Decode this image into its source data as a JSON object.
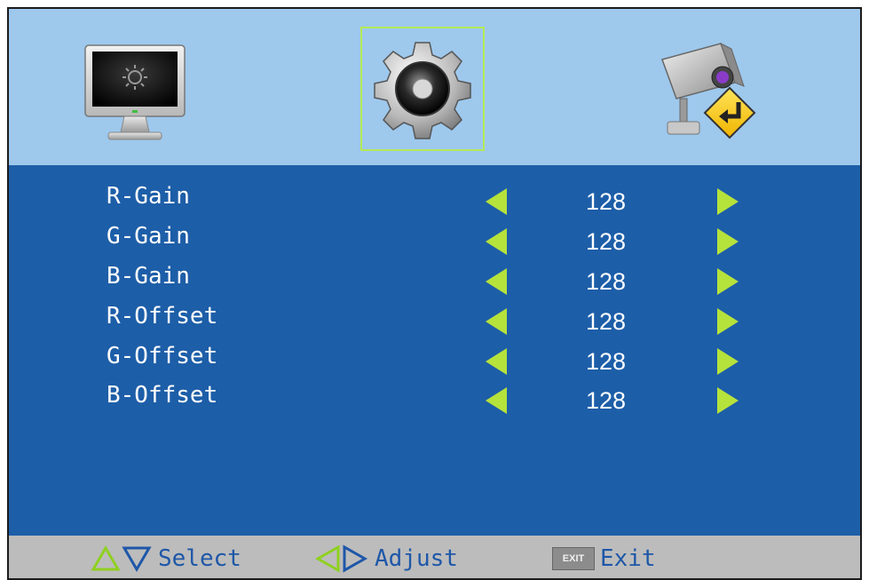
{
  "tabs": [
    {
      "name": "monitor-icon"
    },
    {
      "name": "gear-icon",
      "selected": true
    },
    {
      "name": "camera-source-icon"
    }
  ],
  "rows": [
    {
      "label": "R-Gain",
      "value": "128"
    },
    {
      "label": "G-Gain",
      "value": "128"
    },
    {
      "label": "B-Gain",
      "value": "128"
    },
    {
      "label": "R-Offset",
      "value": "128"
    },
    {
      "label": "G-Offset",
      "value": "128"
    },
    {
      "label": "B-Offset",
      "value": "128"
    }
  ],
  "footer": {
    "select_label": "Select",
    "adjust_label": "Adjust",
    "exit_key": "EXIT",
    "exit_label": "Exit"
  },
  "colors": {
    "panel": "#1d5ea8",
    "header": "#9ec8ec",
    "arrow": "#b6e23c",
    "footer_text": "#1e57a8",
    "selection_border": "#b4ea55"
  }
}
